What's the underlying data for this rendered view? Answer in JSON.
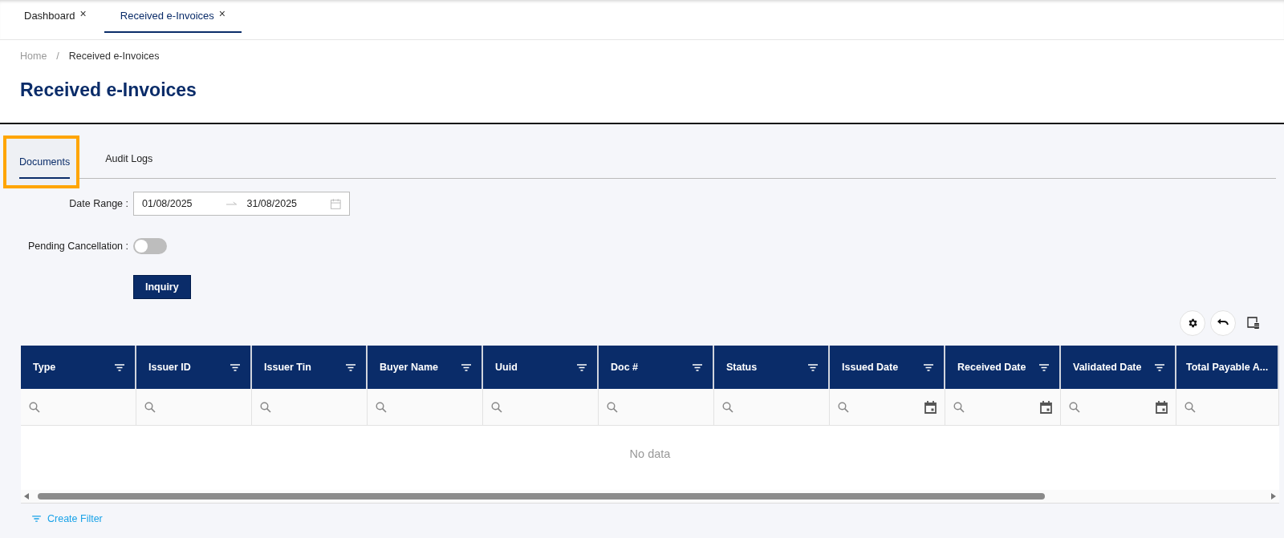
{
  "window_tabs": [
    {
      "label": "Dashboard",
      "close": "×",
      "selected": false
    },
    {
      "label": "Received e-Invoices",
      "close": "×",
      "selected": true
    }
  ],
  "breadcrumb": {
    "items": [
      "Home",
      "Received e-Invoices"
    ],
    "separator": "/"
  },
  "title": "Received e-Invoices",
  "tabs": [
    {
      "label": "Documents",
      "selected": true,
      "highlighted": true
    },
    {
      "label": "Audit Logs",
      "selected": false,
      "highlighted": false
    }
  ],
  "date_range": {
    "label": "Date Range :",
    "start": "01/08/2025",
    "end": "31/08/2025"
  },
  "pending_cancellation": {
    "label": "Pending Cancellation :",
    "on": false
  },
  "inquiry_button": "Inquiry",
  "table": {
    "columns": [
      {
        "label": "Type",
        "menu": true,
        "kind": "text"
      },
      {
        "label": "Issuer ID",
        "menu": true,
        "kind": "text"
      },
      {
        "label": "Issuer Tin",
        "menu": true,
        "kind": "text"
      },
      {
        "label": "Buyer Name",
        "menu": true,
        "kind": "text"
      },
      {
        "label": "Uuid",
        "menu": true,
        "kind": "text"
      },
      {
        "label": "Doc #",
        "menu": true,
        "kind": "text"
      },
      {
        "label": "Status",
        "menu": true,
        "kind": "text"
      },
      {
        "label": "Issued Date",
        "menu": true,
        "kind": "date"
      },
      {
        "label": "Received Date",
        "menu": true,
        "kind": "date"
      },
      {
        "label": "Validated Date",
        "menu": true,
        "kind": "date"
      },
      {
        "label": "Total Payable A...",
        "menu": false,
        "kind": "text"
      }
    ],
    "empty_text": "No data"
  },
  "create_filter": "Create Filter"
}
